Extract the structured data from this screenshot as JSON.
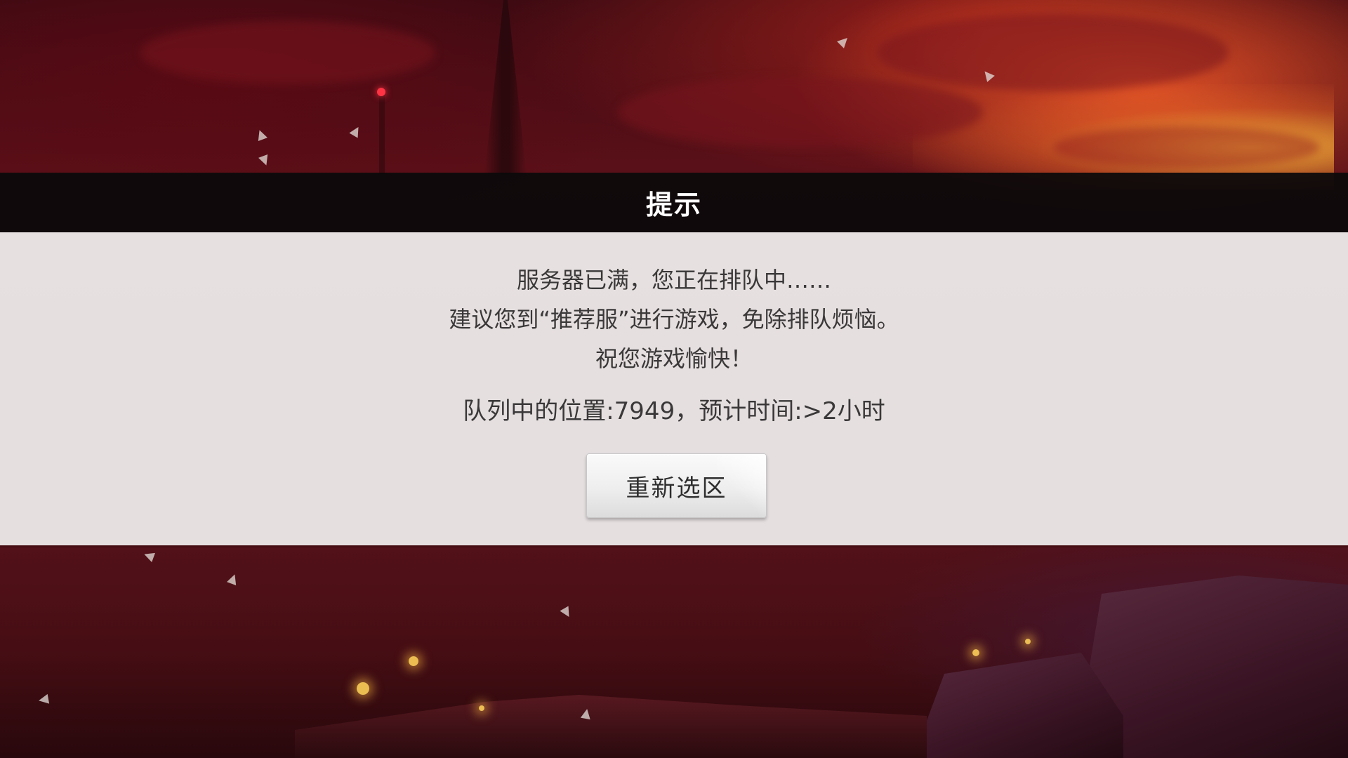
{
  "dialog": {
    "title": "提示",
    "message_lines": [
      "服务器已满，您正在排队中……",
      "建议您到“推荐服”进行游戏，免除排队烦恼。",
      "祝您游戏愉快！"
    ],
    "queue_position": "队列中的位置:7949，预计时间:>2小时",
    "reselect_button_label": "重新选区"
  },
  "colors": {
    "title_bar": "#0c0a0b",
    "dialog_body": "#f2f0f0",
    "text": "#3a3838",
    "background_sky": "#5a1018",
    "sunset_glow": "#f05a28"
  }
}
